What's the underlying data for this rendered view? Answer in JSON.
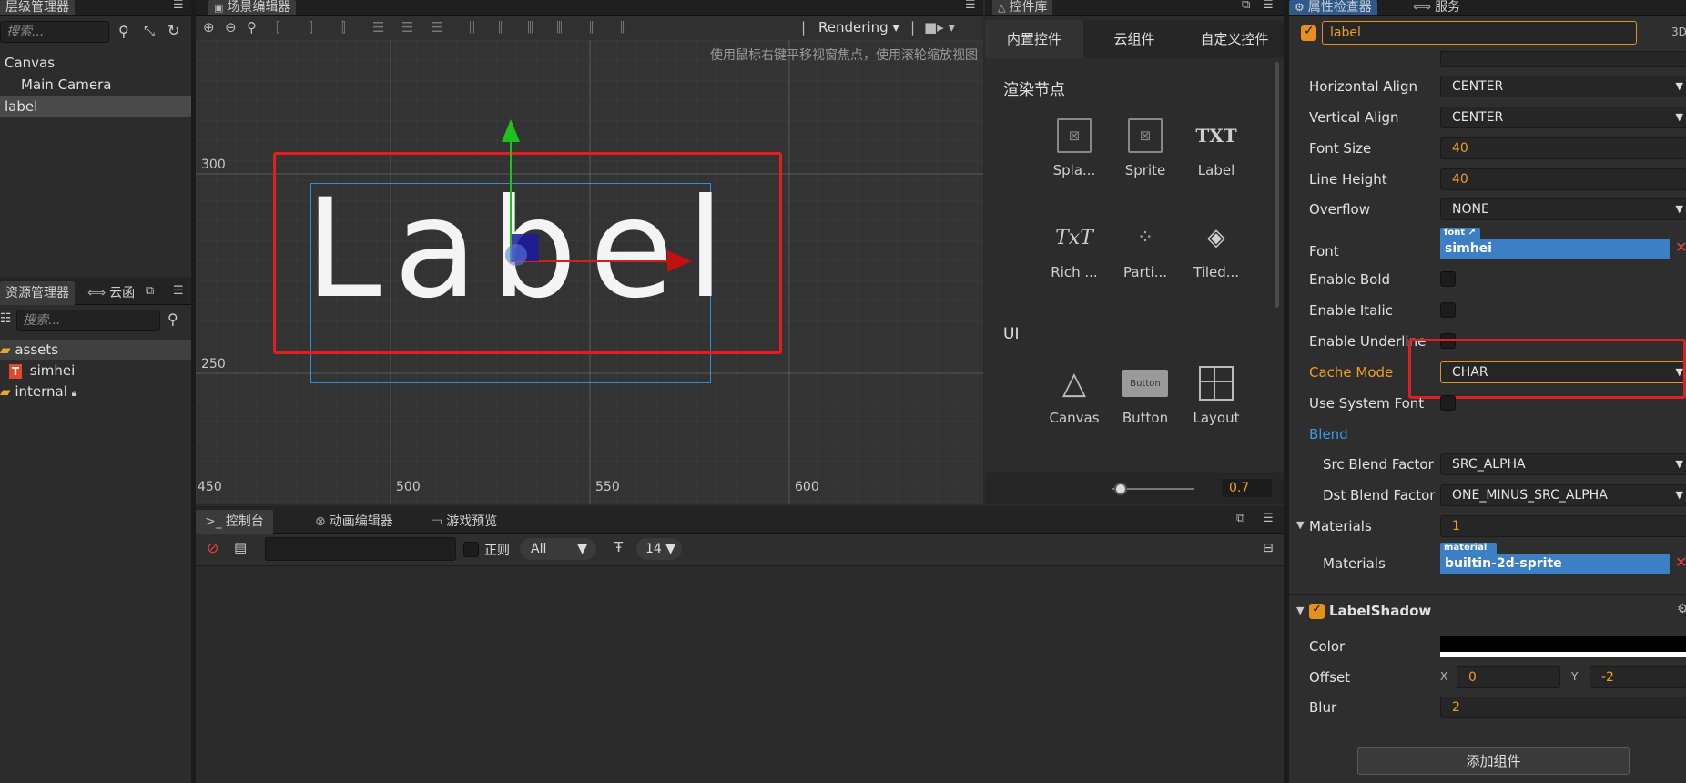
{
  "hierarchy": {
    "title": "层级管理器",
    "search_placeholder": "搜索...",
    "items": [
      "Canvas",
      "Main Camera",
      "label"
    ]
  },
  "assets": {
    "title": "资源管理器",
    "cloud_tab": "云函",
    "search_placeholder": "搜索...",
    "items": [
      "assets",
      "simhei",
      "internal"
    ]
  },
  "scene": {
    "title": "场景编辑器",
    "render_mode": "Rendering",
    "hint": "使用鼠标右键平移视窗焦点，使用滚轮缩放视图",
    "label_text": "Label",
    "y_ticks": [
      "300",
      "250"
    ],
    "x_ticks": [
      "450",
      "500",
      "550",
      "600"
    ]
  },
  "library": {
    "title": "控件库",
    "tabs": [
      "内置控件",
      "云组件",
      "自定义控件"
    ],
    "section_render": "渲染节点",
    "render_items": [
      "Spla...",
      "Sprite",
      "Label",
      "Rich ...",
      "Parti...",
      "Tiled..."
    ],
    "section_ui": "UI",
    "ui_items": [
      "Canvas",
      "Button",
      "Layout"
    ],
    "button_icon_text": "Button",
    "label_icon_text": "TXT",
    "rich_icon_text": "TxT",
    "zoom": "0.7"
  },
  "console": {
    "tabs": [
      "控制台",
      "动画编辑器",
      "游戏预览"
    ],
    "regex_label": "正则",
    "level": "All",
    "font_size": "14"
  },
  "inspector": {
    "title": "属性检查器",
    "service_tab": "服务",
    "node_name": "label",
    "mode_3d": "3D",
    "rows": {
      "h_align_label": "Horizontal Align",
      "h_align": "CENTER",
      "v_align_label": "Vertical Align",
      "v_align": "CENTER",
      "font_size_label": "Font Size",
      "font_size": "40",
      "line_height_label": "Line Height",
      "line_height": "40",
      "overflow_label": "Overflow",
      "overflow": "NONE",
      "font_label": "Font",
      "font_tag": "font",
      "font": "simhei",
      "bold_label": "Enable Bold",
      "italic_label": "Enable Italic",
      "underline_label": "Enable Underline",
      "cache_label": "Cache Mode",
      "cache": "CHAR",
      "sysfont_label": "Use System Font",
      "blend_label": "Blend",
      "src_label": "Src Blend Factor",
      "src": "SRC_ALPHA",
      "dst_label": "Dst Blend Factor",
      "dst": "ONE_MINUS_SRC_ALPHA",
      "materials_label": "Materials",
      "materials_count": "1",
      "material_label": "Materials",
      "material_tag": "material",
      "material": "builtin-2d-sprite"
    },
    "shadow": {
      "title": "LabelShadow",
      "color_label": "Color",
      "offset_label": "Offset",
      "x_axis": "X",
      "offset_x": "0",
      "y_axis": "Y",
      "offset_y": "-2",
      "blur_label": "Blur",
      "blur": "2"
    },
    "add_component": "添加组件"
  },
  "colors": {
    "accent": "#e6901e",
    "highlight_red": "#e02020",
    "selection_blue": "#3c7fc4"
  }
}
